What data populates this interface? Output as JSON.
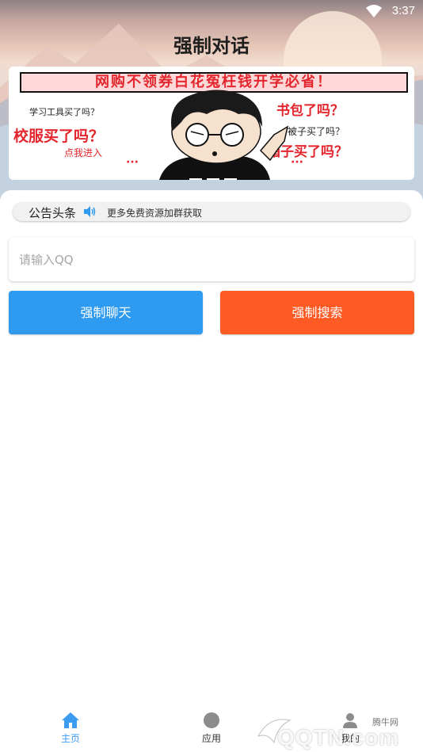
{
  "status_bar": {
    "time": "3:37"
  },
  "header": {
    "title": "强制对话"
  },
  "banner": {
    "headline": "网购不领券白花冤枉钱开学必省！",
    "left_small": "学习工具买了吗？",
    "left_big": "校服买了吗？",
    "cta": "点我进入",
    "right_1": "书包了吗？",
    "right_2": "被子买了吗？",
    "right_3": "箱子买了吗？",
    "dots_left": "···",
    "dots_right": "···"
  },
  "notice": {
    "label": "公告头条",
    "icon": "speaker-icon",
    "text": "更多免费资源加群获取"
  },
  "form": {
    "qq_placeholder": "请输入QQ",
    "qq_value": ""
  },
  "buttons": {
    "chat_label": "强制聊天",
    "chat_color": "#2f9bf0",
    "search_label": "强制搜索",
    "search_color": "#fd5a24"
  },
  "bottom_nav": {
    "items": [
      {
        "label": "主页",
        "icon": "home-icon",
        "active": true
      },
      {
        "label": "应用",
        "icon": "compass-icon",
        "active": false
      },
      {
        "label": "我的",
        "icon": "user-icon",
        "active": false
      }
    ],
    "active_color": "#3c9cf2"
  },
  "watermark": {
    "brand": "腾牛网",
    "domain": "QQTN.com"
  }
}
